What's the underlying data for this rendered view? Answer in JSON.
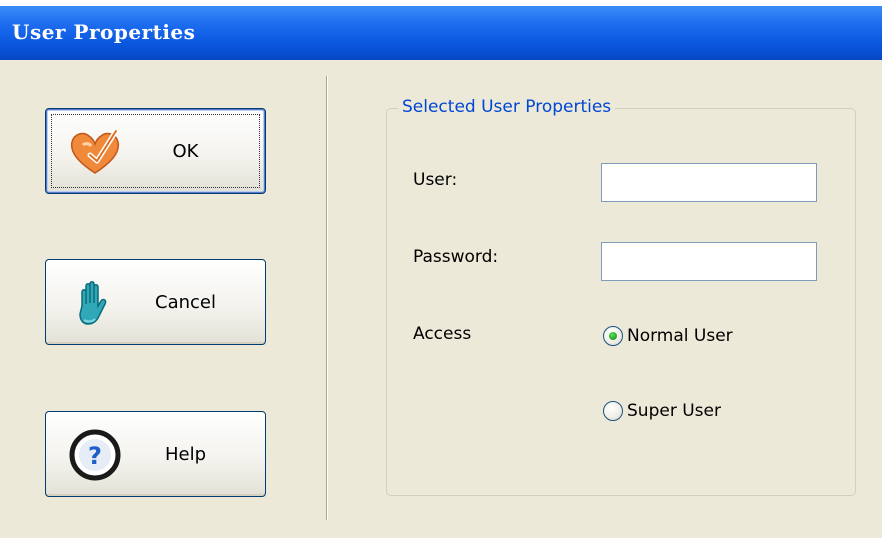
{
  "window": {
    "title": "User Properties"
  },
  "buttons": {
    "ok": {
      "label": "OK",
      "icon": "check-heart-icon"
    },
    "cancel": {
      "label": "Cancel",
      "icon": "hand-icon"
    },
    "help": {
      "label": "Help",
      "icon": "question-icon"
    }
  },
  "group": {
    "legend": "Selected User Properties",
    "user_label": "User:",
    "user_value": "",
    "password_label": "Password:",
    "password_value": "",
    "access_label": "Access",
    "access_options": [
      {
        "label": "Normal User",
        "checked": true
      },
      {
        "label": "Super User",
        "checked": false
      }
    ]
  },
  "colors": {
    "titlebar": "#0a57df",
    "dialog_bg": "#ece9d8",
    "group_legend": "#0046d5",
    "radio_dot": "#21a121"
  }
}
